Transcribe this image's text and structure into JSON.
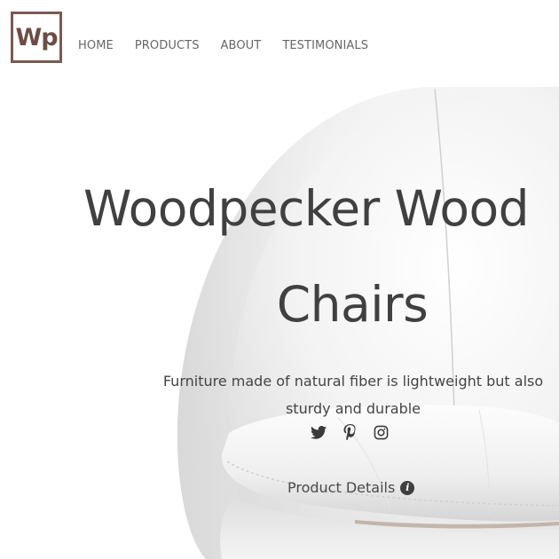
{
  "logo": {
    "text": "Wp"
  },
  "nav": {
    "items": [
      {
        "label": "HOME"
      },
      {
        "label": "PRODUCTS"
      },
      {
        "label": "ABOUT"
      },
      {
        "label": "TESTIMONIALS"
      }
    ]
  },
  "hero": {
    "title_line1": "Woodpecker Wood",
    "title_line2": "Chairs",
    "subtitle": "Furniture made of natural fiber is lightweight but also sturdy and durable",
    "image": "white-leather-egg-chair"
  },
  "social": {
    "icons": [
      "twitter-icon",
      "pinterest-icon",
      "instagram-icon"
    ]
  },
  "cta": {
    "label": "Product Details",
    "icon": "info-circle-icon"
  },
  "colors": {
    "logo": "#6d4c45",
    "nav_text": "#666666",
    "heading": "#404040",
    "body_text": "#444444"
  }
}
